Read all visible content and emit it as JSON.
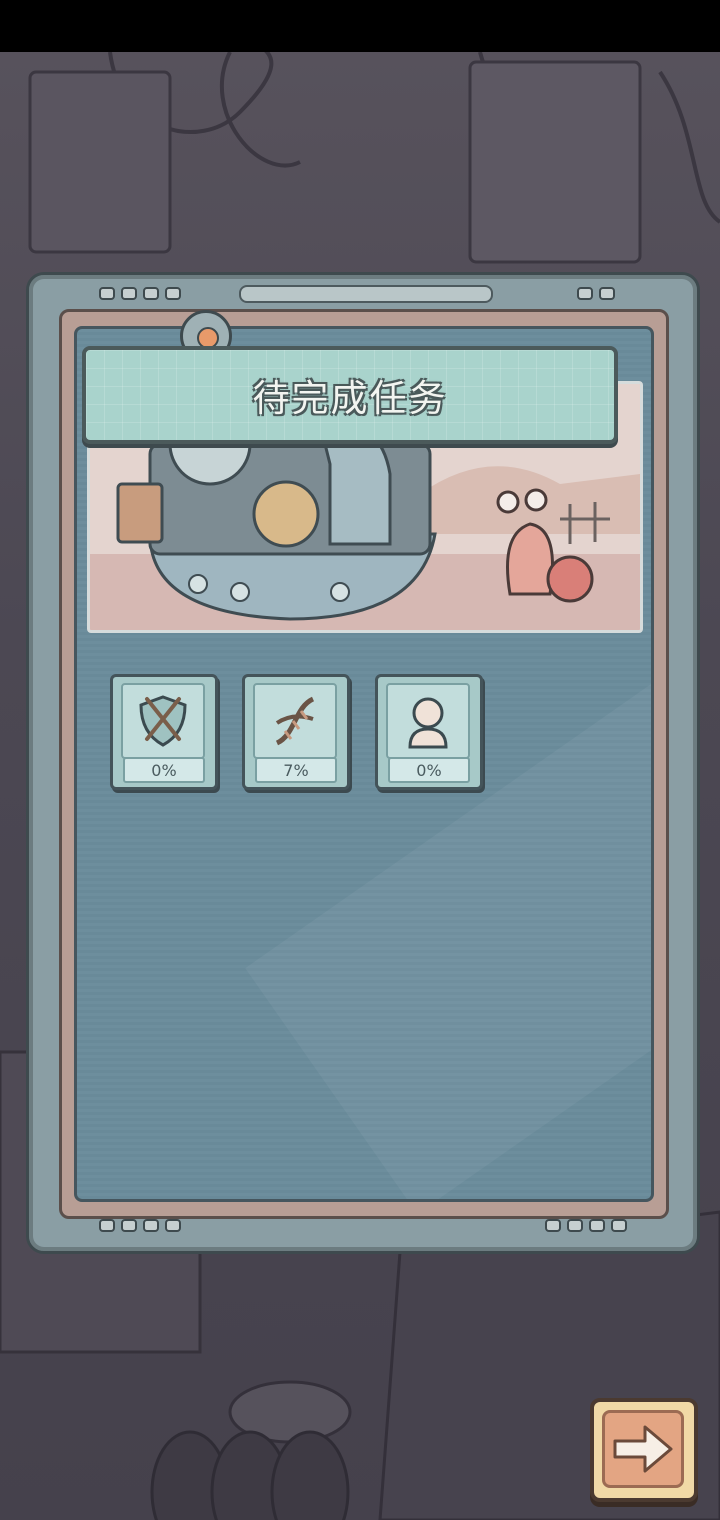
{
  "panel": {
    "title": "待完成任务"
  },
  "tasks": [
    {
      "icon": "shield-icon",
      "progress": "0%"
    },
    {
      "icon": "dna-helix-icon",
      "progress": "7%"
    },
    {
      "icon": "bust-statue-icon",
      "progress": "0%"
    }
  ],
  "navigation": {
    "next_icon": "arrow-right-icon"
  },
  "colors": {
    "banner": "#a9d3cc",
    "screen": "#6d8e9d",
    "next_button": "#f1d9a6"
  }
}
